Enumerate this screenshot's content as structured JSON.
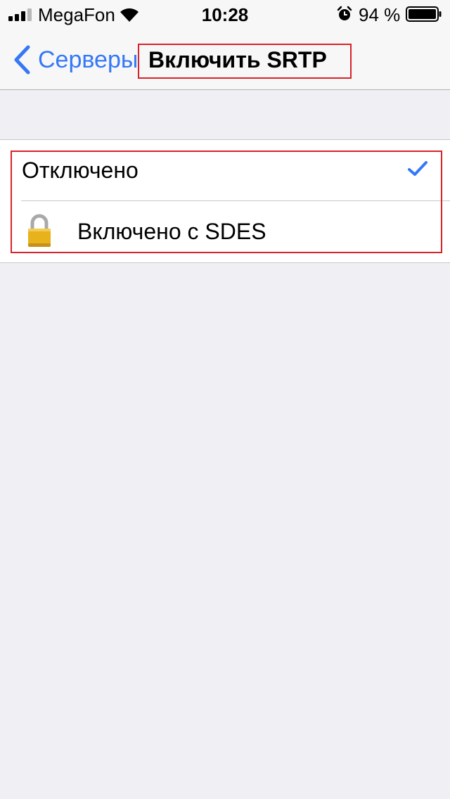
{
  "status_bar": {
    "carrier": "MegaFon",
    "time": "10:28",
    "battery_percent": "94 %",
    "signal_bars_active": 3,
    "signal_bars_total": 4,
    "battery_level": 0.94,
    "icons": [
      "signal-icon",
      "wifi-icon",
      "alarm-icon",
      "battery-icon"
    ]
  },
  "nav": {
    "back_label": "Серверы",
    "title": "Включить SRTP"
  },
  "options": [
    {
      "label": "Отключено",
      "selected": true,
      "icon": "checkmark-icon"
    },
    {
      "label": "Включено с SDES",
      "selected": false,
      "icon": "lock-icon"
    }
  ],
  "colors": {
    "accent": "#3478f6",
    "background": "#efeff4",
    "highlight": "#d8232a",
    "lock_gold": "#e8b21c"
  }
}
